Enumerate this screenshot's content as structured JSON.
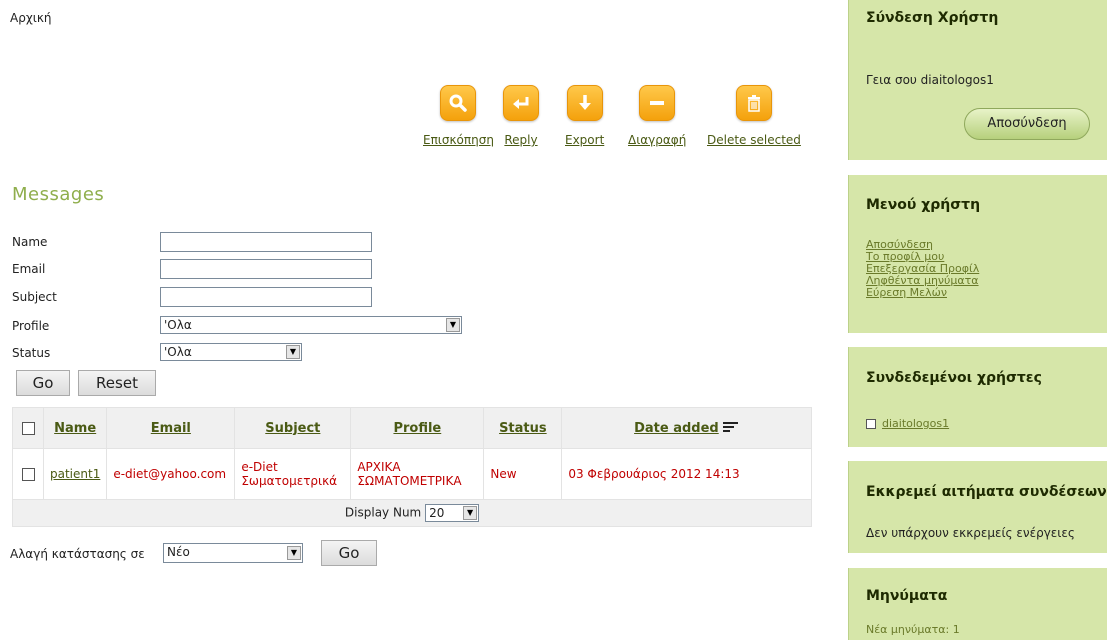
{
  "breadcrumb": "Αρχική",
  "toolbar": {
    "preview_label": "Επισκόπηση",
    "reply_label": "Reply",
    "export_label": "Export",
    "delete_label": "Διαγραφή",
    "delete_selected_label": "Delete selected"
  },
  "messages_title": "Messages",
  "filters": {
    "name_label": "Name",
    "email_label": "Email",
    "subject_label": "Subject",
    "profile_label": "Profile",
    "profile_value": "'Ολα",
    "status_label": "Status",
    "status_value": "'Ολα",
    "go_label": "Go",
    "reset_label": "Reset"
  },
  "table": {
    "headers": [
      "Name",
      "Email",
      "Subject",
      "Profile",
      "Status",
      "Date added"
    ],
    "rows": [
      {
        "name": "patient1",
        "email": "e-diet@yahoo.com",
        "subject": "e-Diet Σωματομετρικά",
        "profile": "ΑΡΧΙΚΑ ΣΩΜΑΤΟΜΕΤΡΙΚΑ",
        "status": "New",
        "date": "03 Φεβρουάριος 2012 14:13"
      }
    ],
    "display_num_label": "Display Num",
    "display_num_value": "20"
  },
  "bulk": {
    "label": "Αλαγή κατάστασης σε",
    "value": "Νέο",
    "go_label": "Go"
  },
  "sidebar": {
    "login": {
      "title": "Σύνδεση Χρήστη",
      "greeting": "Γεια σου diaitologos1",
      "logout_button": "Αποσύνδεση"
    },
    "menu": {
      "title": "Μενού χρήστη",
      "items": [
        "Αποσύνδεση",
        "Το προφίλ μου",
        "Επεξεργασία Προφίλ",
        "Ληφθέντα μηνύματα",
        "Εύρεση Μελών"
      ]
    },
    "online": {
      "title": "Συνδεδεμένοι χρήστες",
      "users": [
        "diaitologos1"
      ]
    },
    "pending": {
      "title": "Εκκρεμεί αιτήματα συνδέσεων",
      "text": "Δεν υπάρχουν εκκρεμείς ενέργειες"
    },
    "msgs": {
      "title": "Μηνύματα",
      "text": "Νέα μηνύματα: 1"
    }
  },
  "colors": {
    "accent_orange": "#f4a10c",
    "sidebar_green": "#d6e6a9",
    "title_green": "#8fae4c",
    "link_olive": "#4a5a14",
    "data_red": "#c00000"
  }
}
